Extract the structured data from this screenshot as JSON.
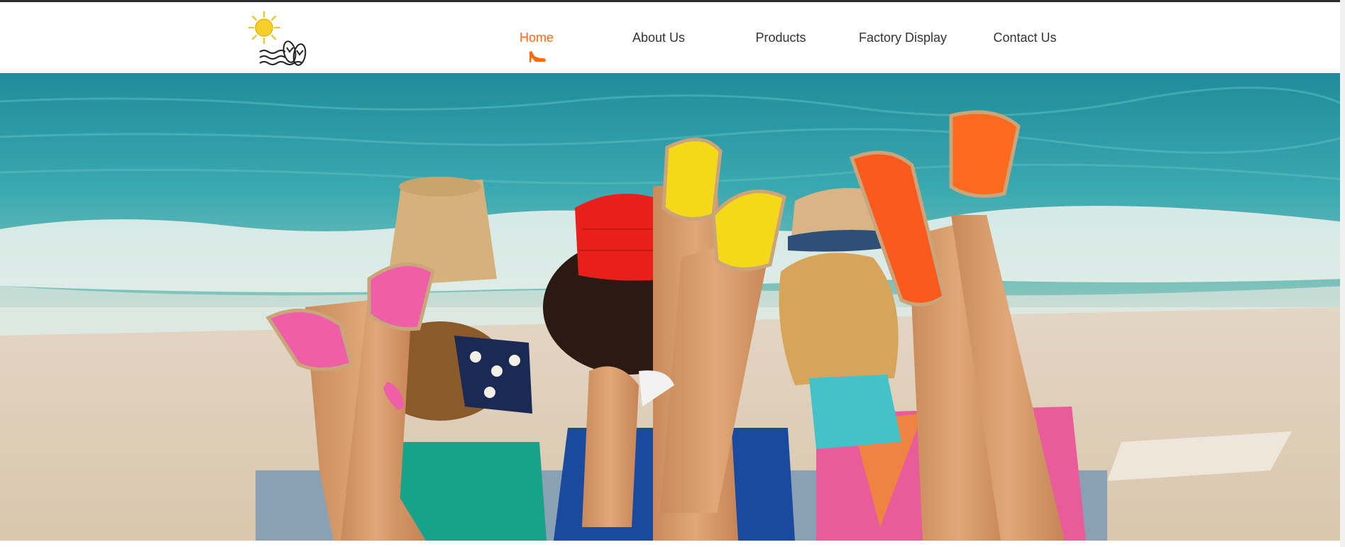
{
  "logo": {
    "icon": "sun-beach-sandals-logo-icon"
  },
  "nav": {
    "items": [
      {
        "label": "Home",
        "active": true
      },
      {
        "label": "About Us",
        "active": false
      },
      {
        "label": "Products",
        "active": false
      },
      {
        "label": "Factory Display",
        "active": false
      },
      {
        "label": "Contact Us",
        "active": false
      }
    ],
    "active_indicator_icon": "high-heel-shoe-icon"
  },
  "colors": {
    "accent": "#ff6a13",
    "nav_text": "#333333",
    "top_rule": "#2b2b2b"
  },
  "hero": {
    "image": "banner-photo-three-women-lying-on-beach-wearing-espadrilles"
  }
}
